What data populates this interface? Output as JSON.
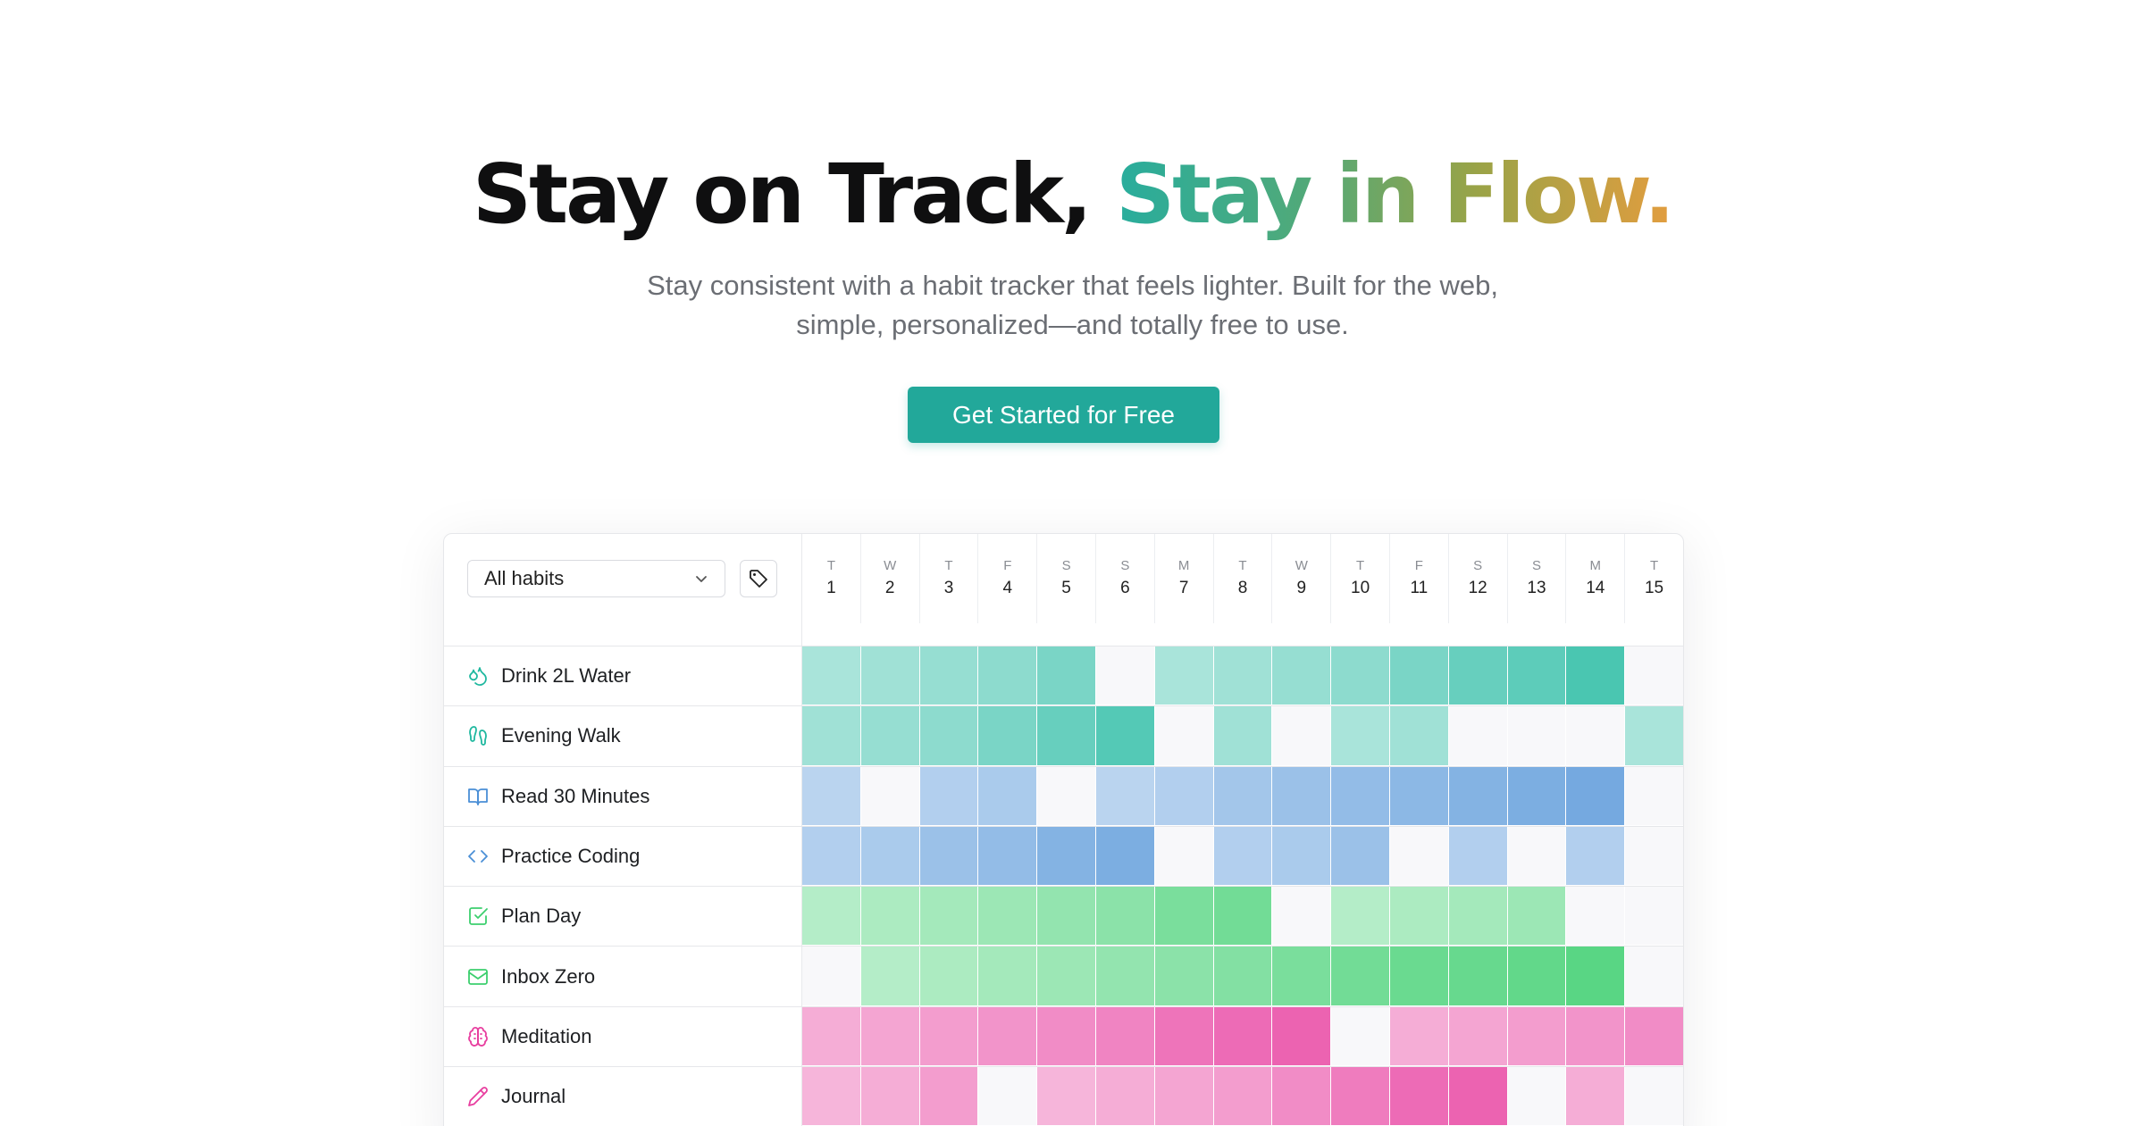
{
  "hero": {
    "headline_dark": "Stay on Track, ",
    "headline_accent": "Stay in Flow.",
    "subtitle_line1": "Stay consistent with a habit tracker that feels lighter. Built for the web,",
    "subtitle_line2": "simple, personalized—and totally free to use.",
    "cta_label": "Get Started for Free"
  },
  "colors": {
    "accent": "#22a89a",
    "empty_cell": "#f8f8fa",
    "gradient": [
      "#28ad9d",
      "#52a978",
      "#9aa347",
      "#e29d3f"
    ]
  },
  "tracker": {
    "filter_value": "All habits",
    "days": [
      {
        "wd": "T",
        "dn": "1"
      },
      {
        "wd": "W",
        "dn": "2"
      },
      {
        "wd": "T",
        "dn": "3"
      },
      {
        "wd": "F",
        "dn": "4"
      },
      {
        "wd": "S",
        "dn": "5"
      },
      {
        "wd": "S",
        "dn": "6"
      },
      {
        "wd": "M",
        "dn": "7"
      },
      {
        "wd": "T",
        "dn": "8"
      },
      {
        "wd": "W",
        "dn": "9"
      },
      {
        "wd": "T",
        "dn": "10"
      },
      {
        "wd": "F",
        "dn": "11"
      },
      {
        "wd": "S",
        "dn": "12"
      },
      {
        "wd": "S",
        "dn": "13"
      },
      {
        "wd": "M",
        "dn": "14"
      },
      {
        "wd": "T",
        "dn": "15"
      }
    ],
    "habits": [
      {
        "name": "Drink 2L Water",
        "icon": "droplets-icon",
        "color": "#1fb89f",
        "levels": [
          0.45,
          0.5,
          0.55,
          0.6,
          0.7,
          0,
          0.45,
          0.5,
          0.55,
          0.6,
          0.7,
          0.8,
          0.85,
          0.95,
          0
        ]
      },
      {
        "name": "Evening Walk",
        "icon": "footprints-icon",
        "color": "#1fb89f",
        "levels": [
          0.5,
          0.55,
          0.6,
          0.7,
          0.8,
          0.9,
          0,
          0.5,
          0,
          0.45,
          0.5,
          0,
          0,
          0,
          0.45
        ]
      },
      {
        "name": "Read 30 Minutes",
        "icon": "book-icon",
        "color": "#4a8fd6",
        "levels": [
          0.45,
          0,
          0.5,
          0.55,
          0,
          0.45,
          0.5,
          0.6,
          0.65,
          0.7,
          0.75,
          0.8,
          0.85,
          0.9,
          0
        ]
      },
      {
        "name": "Practice Coding",
        "icon": "code-icon",
        "color": "#4a8fd6",
        "levels": [
          0.5,
          0.55,
          0.65,
          0.7,
          0.8,
          0.85,
          0,
          0.5,
          0.55,
          0.65,
          0,
          0.5,
          0,
          0.5,
          0
        ]
      },
      {
        "name": "Plan Day",
        "icon": "checkbox-icon",
        "color": "#3ccf6e",
        "levels": [
          0.45,
          0.5,
          0.55,
          0.6,
          0.65,
          0.7,
          0.8,
          0.85,
          0,
          0.45,
          0.5,
          0.55,
          0.6,
          0,
          0
        ]
      },
      {
        "name": "Inbox Zero",
        "icon": "mail-icon",
        "color": "#3ccf6e",
        "levels": [
          0,
          0.45,
          0.5,
          0.55,
          0.6,
          0.65,
          0.7,
          0.75,
          0.8,
          0.85,
          0.9,
          0.92,
          0.95,
          1.0,
          0
        ]
      },
      {
        "name": "Meditation",
        "icon": "brain-icon",
        "color": "#e83e9f",
        "levels": [
          0.5,
          0.55,
          0.6,
          0.65,
          0.7,
          0.75,
          0.85,
          0.9,
          0.95,
          0,
          0.5,
          0.55,
          0.6,
          0.65,
          0.7
        ]
      },
      {
        "name": "Journal",
        "icon": "pencil-icon",
        "color": "#e83e9f",
        "levels": [
          0.45,
          0.5,
          0.6,
          0,
          0.45,
          0.5,
          0.55,
          0.6,
          0.7,
          0.8,
          0.9,
          0.95,
          0,
          0.5,
          0
        ]
      }
    ]
  }
}
